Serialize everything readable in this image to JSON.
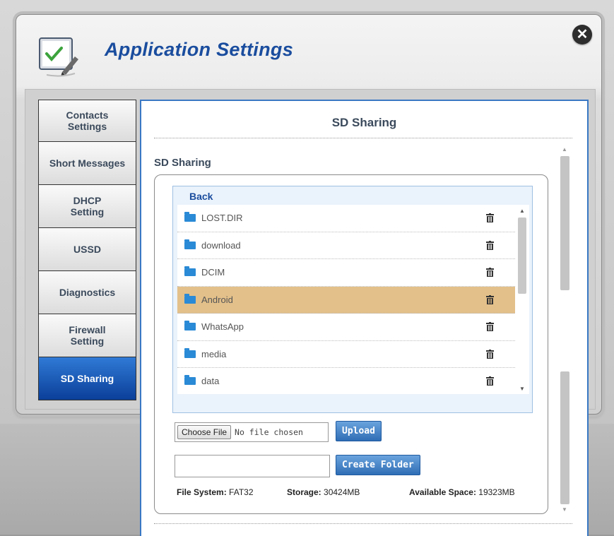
{
  "window": {
    "title": "Application Settings",
    "close_icon": "close-icon",
    "app_icon": "settings-checklist-icon"
  },
  "sidebar": {
    "items": [
      {
        "label": "Contacts Settings"
      },
      {
        "label": "Short Messages"
      },
      {
        "label": "DHCP Setting"
      },
      {
        "label": "USSD"
      },
      {
        "label": "Diagnostics"
      },
      {
        "label": "Firewall Setting"
      },
      {
        "label": "SD Sharing",
        "active": true
      }
    ]
  },
  "main": {
    "title": "SD Sharing",
    "section_label": "SD Sharing",
    "back_label": "Back",
    "files": [
      {
        "name": "LOST.DIR"
      },
      {
        "name": "download"
      },
      {
        "name": "DCIM"
      },
      {
        "name": "Android",
        "selected": true
      },
      {
        "name": "WhatsApp"
      },
      {
        "name": "media"
      },
      {
        "name": "data"
      }
    ],
    "choose_file_label": "Choose File",
    "no_file_text": "No file chosen",
    "upload_label": "Upload",
    "folder_name_value": "",
    "create_folder_label": "Create Folder",
    "stats": {
      "fs_label": "File System:",
      "fs_value": "FAT32",
      "storage_label": "Storage:",
      "storage_value": "30424MB",
      "available_label": "Available Space:",
      "available_value": "19323MB"
    }
  },
  "colors": {
    "accent": "#1a4d9e",
    "active_tab": "#0b3f9a",
    "selected_row": "#e3c08a",
    "folder": "#2a8ad6"
  }
}
